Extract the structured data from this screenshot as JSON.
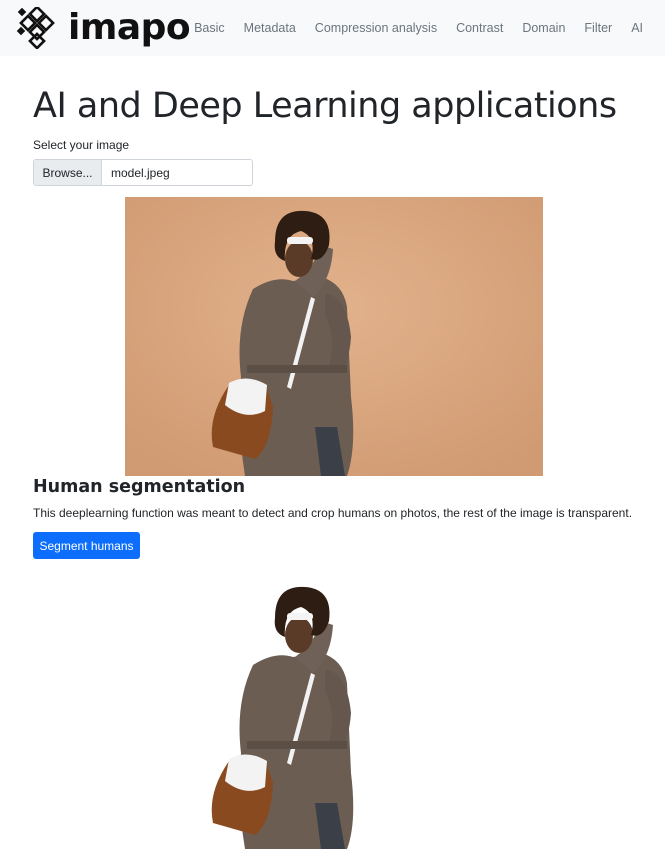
{
  "navbar": {
    "brand": "imapo",
    "links": [
      "Basic",
      "Metadata",
      "Compression analysis",
      "Contrast",
      "Domain",
      "Filter",
      "AI"
    ]
  },
  "main": {
    "title": "AI and Deep Learning applications",
    "select_label": "Select your image",
    "file_input": {
      "button_label": "Browse...",
      "file_name": "model.jpeg"
    }
  },
  "segmentation": {
    "heading": "Human segmentation",
    "description": "This deeplearning function was meant to detect and crop humans on photos, the rest of the image is transparent.",
    "button_label": "Segment humans"
  },
  "colors": {
    "navbar_bg": "#f8f9fa",
    "primary": "#0d6efd",
    "photo_bg": "#d8a680"
  }
}
